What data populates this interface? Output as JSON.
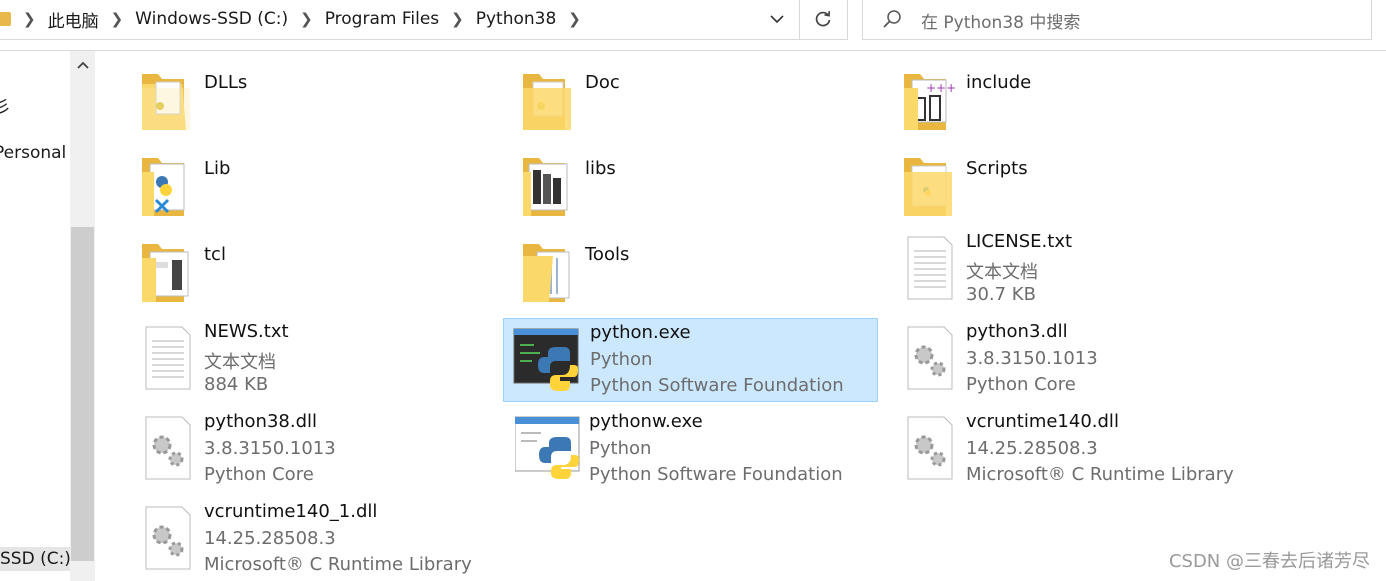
{
  "breadcrumb": [
    "此电脑",
    "Windows-SSD (C:)",
    "Program Files",
    "Python38"
  ],
  "search": {
    "placeholder": "在 Python38 中搜索"
  },
  "nav": {
    "items": [
      "彡",
      "Personal",
      "SSD (C:)"
    ]
  },
  "items": [
    {
      "name": "DLLs",
      "kind": "folder",
      "icon": "folder-dll-icon"
    },
    {
      "name": "Doc",
      "kind": "folder",
      "icon": "folder-doc-icon"
    },
    {
      "name": "include",
      "kind": "folder",
      "icon": "folder-include-icon"
    },
    {
      "name": "Lib",
      "kind": "folder",
      "icon": "folder-python-icon"
    },
    {
      "name": "libs",
      "kind": "folder",
      "icon": "folder-libs-icon"
    },
    {
      "name": "Scripts",
      "kind": "folder",
      "icon": "folder-scripts-icon"
    },
    {
      "name": "tcl",
      "kind": "folder",
      "icon": "folder-tcl-icon"
    },
    {
      "name": "Tools",
      "kind": "folder",
      "icon": "folder-tools-icon"
    },
    {
      "name": "LICENSE.txt",
      "kind": "text",
      "icon": "text-file-icon",
      "line2": "文本文档",
      "line3": "30.7 KB"
    },
    {
      "name": "NEWS.txt",
      "kind": "text",
      "icon": "text-file-icon",
      "line2": "文本文档",
      "line3": "884 KB"
    },
    {
      "name": "python.exe",
      "kind": "exe",
      "icon": "python-console-icon",
      "line2": "Python",
      "line3": "Python Software Foundation",
      "selected": true
    },
    {
      "name": "python3.dll",
      "kind": "dll",
      "icon": "dll-gear-icon",
      "line2": "3.8.3150.1013",
      "line3": "Python Core"
    },
    {
      "name": "python38.dll",
      "kind": "dll",
      "icon": "dll-gear-icon",
      "line2": "3.8.3150.1013",
      "line3": "Python Core"
    },
    {
      "name": "pythonw.exe",
      "kind": "exew",
      "icon": "python-window-icon",
      "line2": "Python",
      "line3": "Python Software Foundation"
    },
    {
      "name": "vcruntime140.dll",
      "kind": "dll",
      "icon": "dll-gear-icon",
      "line2": "14.25.28508.3",
      "line3": "Microsoft® C Runtime Library"
    },
    {
      "name": "vcruntime140_1.dll",
      "kind": "dll",
      "icon": "dll-gear-icon",
      "line2": "14.25.28508.3",
      "line3": "Microsoft® C Runtime Library"
    }
  ],
  "watermark": "CSDN @三春去后诸芳尽",
  "colors": {
    "selection_bg": "#cce8ff",
    "selection_border": "#99d1ff",
    "folder": "#f3c552"
  }
}
